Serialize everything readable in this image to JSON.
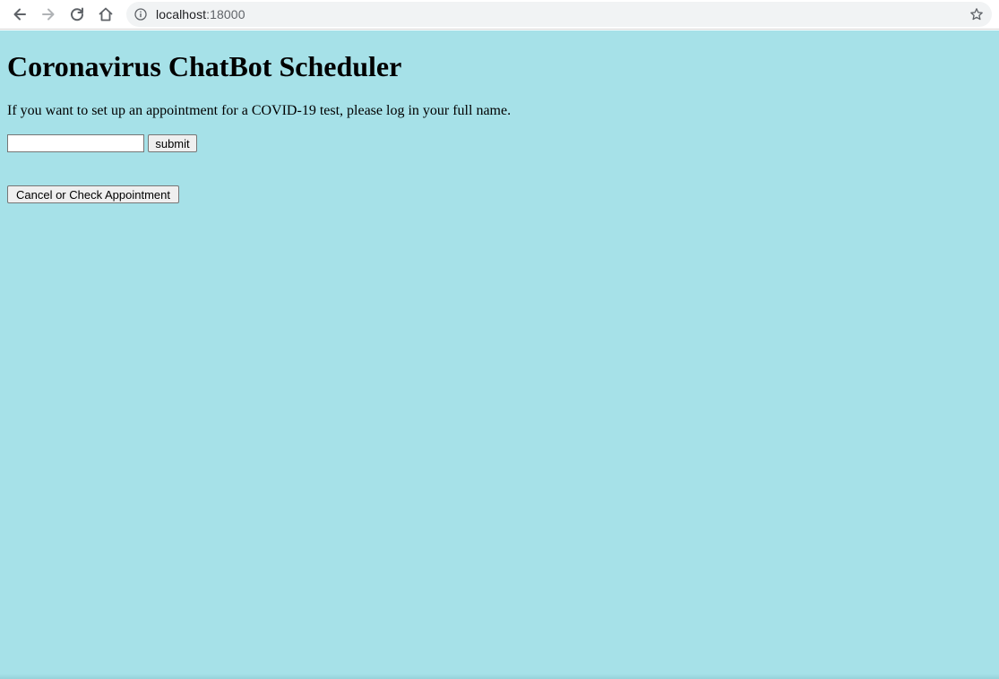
{
  "browser": {
    "url_host": "localhost",
    "url_port": ":18000"
  },
  "page": {
    "background_color": "#a6e1e8",
    "title": "Coronavirus ChatBot Scheduler",
    "intro": "If you want to set up an appointment for a COVID-19 test, please log in your full name.",
    "name_input": {
      "value": "",
      "placeholder": ""
    },
    "submit_label": "submit",
    "cancel_check_label": "Cancel or Check Appointment"
  },
  "icons": {
    "back": "back-arrow-icon",
    "forward": "forward-arrow-icon",
    "reload": "reload-icon",
    "home": "home-icon",
    "info": "info-icon",
    "bookmark": "star-icon"
  }
}
